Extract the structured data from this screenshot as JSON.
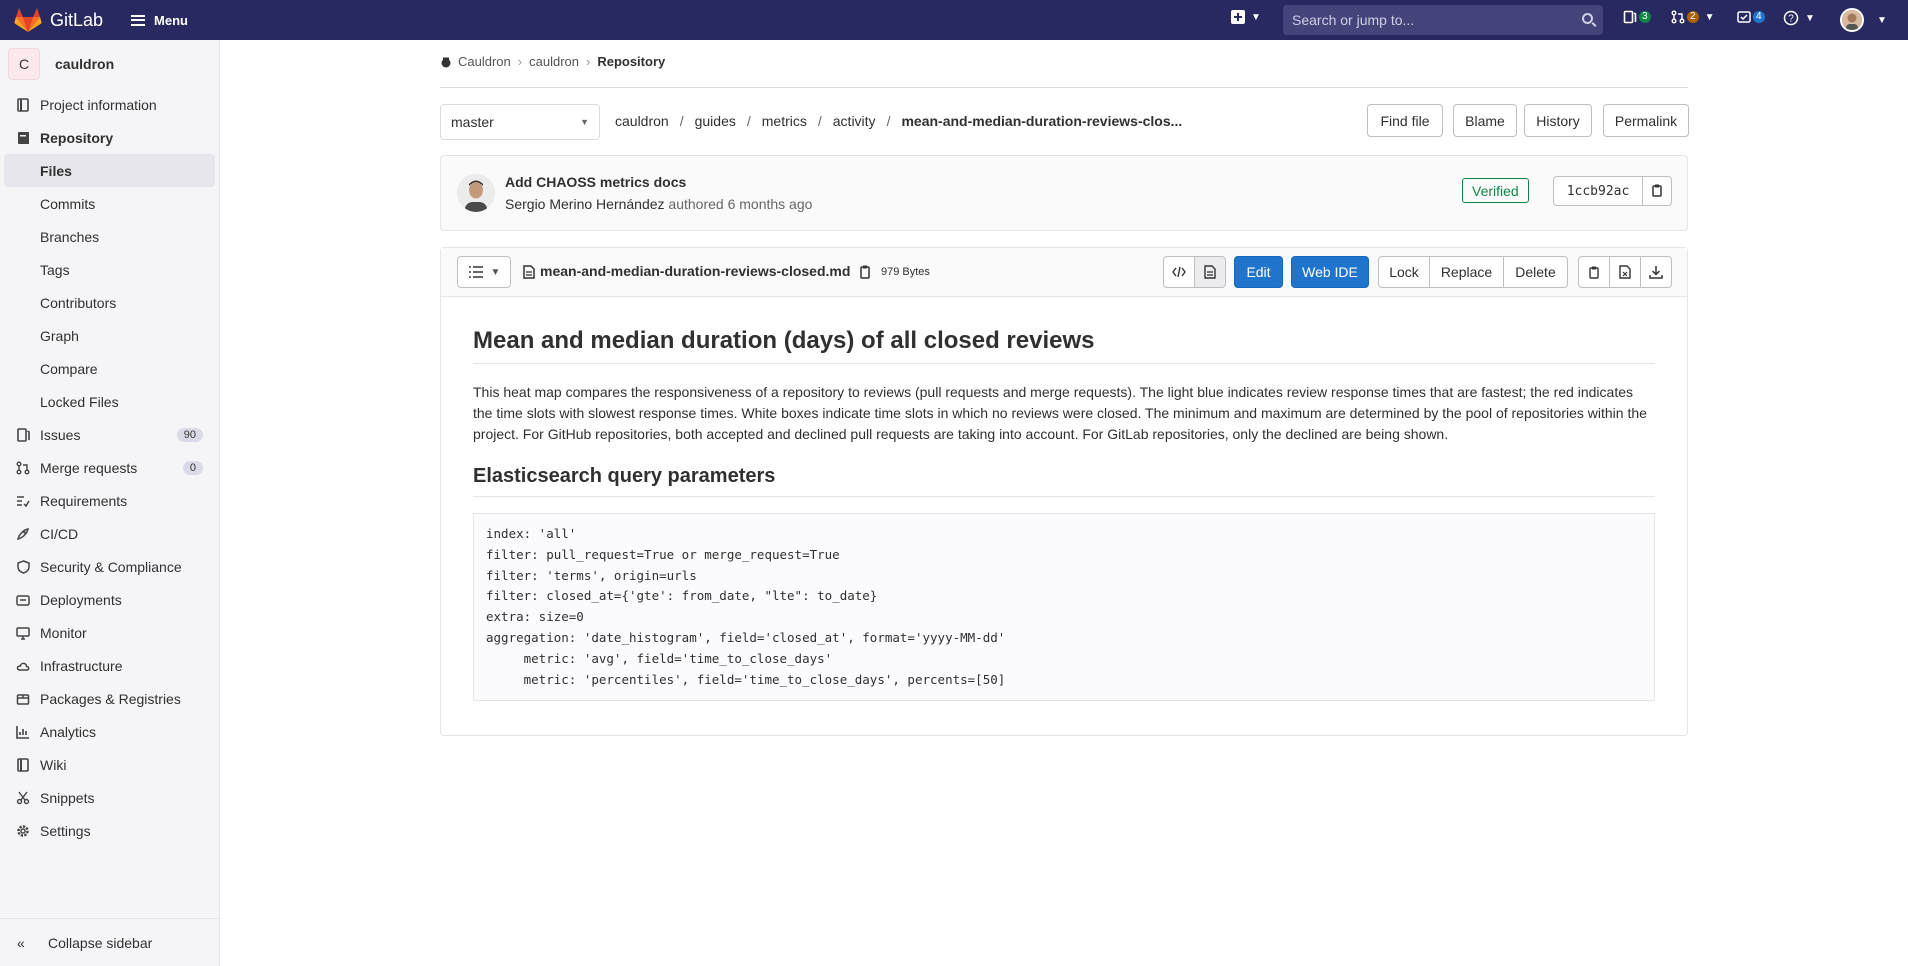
{
  "navbar": {
    "brand": "GitLab",
    "menu_label": "Menu",
    "search_placeholder": "Search or jump to...",
    "issues_count": "3",
    "mr_count": "2",
    "todo_count": "4"
  },
  "sidebar": {
    "project_initial": "C",
    "project_name": "cauldron",
    "items": [
      {
        "label": "Project information",
        "icon": "info-book-icon"
      },
      {
        "label": "Repository",
        "icon": "repository-icon"
      },
      {
        "label": "Files"
      },
      {
        "label": "Commits"
      },
      {
        "label": "Branches"
      },
      {
        "label": "Tags"
      },
      {
        "label": "Contributors"
      },
      {
        "label": "Graph"
      },
      {
        "label": "Compare"
      },
      {
        "label": "Locked Files"
      },
      {
        "label": "Issues",
        "count": "90"
      },
      {
        "label": "Merge requests",
        "count": "0"
      },
      {
        "label": "Requirements"
      },
      {
        "label": "CI/CD"
      },
      {
        "label": "Security & Compliance"
      },
      {
        "label": "Deployments"
      },
      {
        "label": "Monitor"
      },
      {
        "label": "Infrastructure"
      },
      {
        "label": "Packages & Registries"
      },
      {
        "label": "Analytics"
      },
      {
        "label": "Wiki"
      },
      {
        "label": "Snippets"
      },
      {
        "label": "Settings"
      }
    ],
    "collapse_label": "Collapse sidebar"
  },
  "breadcrumb": [
    "Cauldron",
    "cauldron",
    "Repository"
  ],
  "branch": "master",
  "path": [
    "cauldron",
    "guides",
    "metrics",
    "activity",
    "mean-and-median-duration-reviews-clos..."
  ],
  "file_actions": {
    "find_file": "Find file",
    "blame": "Blame",
    "history": "History",
    "permalink": "Permalink"
  },
  "commit": {
    "title": "Add CHAOSS metrics docs",
    "author": "Sergio Merino Hernández",
    "meta": "authored 6 months ago",
    "verified": "Verified",
    "sha": "1ccb92ac"
  },
  "file": {
    "name": "mean-and-median-duration-reviews-closed.md",
    "size": "979 Bytes",
    "edit": "Edit",
    "web_ide": "Web IDE",
    "lock": "Lock",
    "replace": "Replace",
    "delete": "Delete"
  },
  "content": {
    "h1": "Mean and median duration (days) of all closed reviews",
    "paragraph": "This heat map compares the responsiveness of a repository to reviews (pull requests and merge requests). The light blue indicates review response times that are fastest; the red indicates the time slots with slowest response times. White boxes indicate time slots in which no reviews were closed. The minimum and maximum are determined by the pool of repositories within the project. For GitHub repositories, both accepted and declined pull requests are taking into account. For GitLab repositories, only the declined are being shown.",
    "h2": "Elasticsearch query parameters",
    "code": "index: 'all'\nfilter: pull_request=True or merge_request=True\nfilter: 'terms', origin=urls\nfilter: closed_at={'gte': from_date, \"lte\": to_date}\nextra: size=0\naggregation: 'date_histogram', field='closed_at', format='yyyy-MM-dd'\n     metric: 'avg', field='time_to_close_days'\n     metric: 'percentiles', field='time_to_close_days', percents=[50]"
  }
}
